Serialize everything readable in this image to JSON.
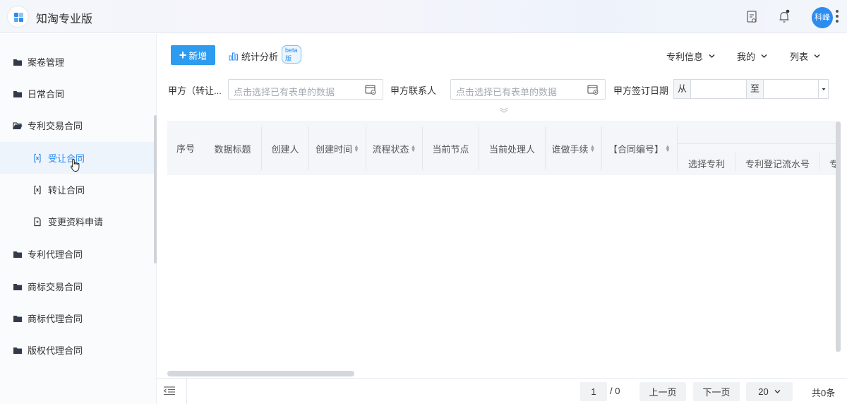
{
  "app": {
    "title": "知淘专业版",
    "avatar_text": "科峰"
  },
  "topbar_icons": [
    "document-icon",
    "bell-icon",
    "more-vertical-icon"
  ],
  "sidebar": {
    "items": [
      {
        "label": "案卷管理",
        "icon": "folder-icon",
        "level": 1
      },
      {
        "label": "日常合同",
        "icon": "folder-icon",
        "level": 1
      },
      {
        "label": "专利交易合同",
        "icon": "folder-open-icon",
        "level": 1,
        "expanded": true
      },
      {
        "label": "受让合同",
        "icon": "contract-icon",
        "level": 2,
        "active": true
      },
      {
        "label": "转让合同",
        "icon": "contract-icon",
        "level": 2
      },
      {
        "label": "变更资料申请",
        "icon": "file-icon",
        "level": 2
      },
      {
        "label": "专利代理合同",
        "icon": "folder-icon",
        "level": 1
      },
      {
        "label": "商标交易合同",
        "icon": "folder-icon",
        "level": 1
      },
      {
        "label": "商标代理合同",
        "icon": "folder-icon",
        "level": 1
      },
      {
        "label": "版权代理合同",
        "icon": "folder-icon",
        "level": 1
      }
    ]
  },
  "toolbar": {
    "new_label": "新增",
    "stats_label": "统计分析",
    "beta_label": "beta版",
    "dropdowns": [
      "专利信息",
      "我的",
      "列表"
    ]
  },
  "filters": {
    "party_a_label": "甲方（转让...",
    "party_a_placeholder": "点击选择已有表单的数据",
    "contact_label": "甲方联系人",
    "contact_placeholder": "点击选择已有表单的数据",
    "sign_date_label": "甲方签订日期",
    "from_label": "从",
    "to_label": "至"
  },
  "table": {
    "columns": [
      "序号",
      "数据标题",
      "创建人",
      "创建时间",
      "流程状态",
      "当前节点",
      "当前处理人",
      "谁做手续",
      "【合同编号】"
    ],
    "sortable": [
      false,
      false,
      false,
      true,
      true,
      false,
      false,
      true,
      true
    ],
    "sub_columns": [
      "选择专利",
      "专利登记流水号",
      "专"
    ]
  },
  "pagination": {
    "page": "1",
    "total_pages": "/ 0",
    "prev_label": "上一页",
    "next_label": "下一页",
    "page_size": "20",
    "total_label": "共0条"
  },
  "colors": {
    "accent": "#2d8cf0",
    "button": "#2d9cf0"
  }
}
